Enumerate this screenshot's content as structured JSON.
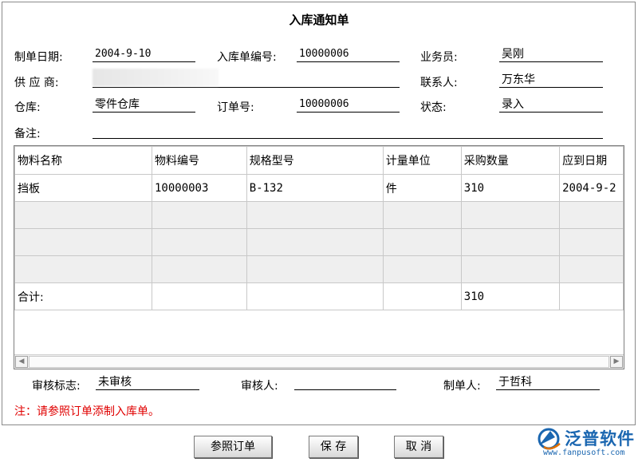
{
  "form": {
    "title": "入库通知单",
    "date_label": "制单日期:",
    "date_value": "2004-9-10",
    "order_no_label": "入库单编号:",
    "order_no_value": "10000006",
    "salesman_label": "业务员:",
    "salesman_value": "吴刚",
    "supplier_label": "供 应 商:",
    "supplier_value": "",
    "contact_label": "联系人:",
    "contact_value": "万东华",
    "warehouse_label": "仓库:",
    "warehouse_value": "零件仓库",
    "purchase_order_label": "订单号:",
    "purchase_order_value": "10000006",
    "status_label": "状态:",
    "status_value": "录入",
    "remark_label": "备注:",
    "remark_value": ""
  },
  "grid": {
    "columns": [
      "物料名称",
      "物料编号",
      "规格型号",
      "计量单位",
      "采购数量",
      "应到日期"
    ],
    "rows": [
      [
        "挡板",
        "10000003",
        "B-132",
        "件",
        "310",
        "2004-9-2"
      ]
    ],
    "total_label": "合计:",
    "total_quantity": "310"
  },
  "footer": {
    "audit_flag_label": "审核标志:",
    "audit_flag_value": "未审核",
    "auditor_label": "审核人:",
    "auditor_value": "",
    "creator_label": "制单人:",
    "creator_value": "于哲科",
    "note": "注：请参照订单添制入库单。"
  },
  "buttons": {
    "reference_order": "参照订单",
    "save": "保 存",
    "cancel": "取 消"
  },
  "logo": {
    "name": "泛普软件",
    "url": "www.fanpusoft.com"
  },
  "colors": {
    "note_red": "#e00000",
    "logo_blue": "#1a66b0"
  }
}
